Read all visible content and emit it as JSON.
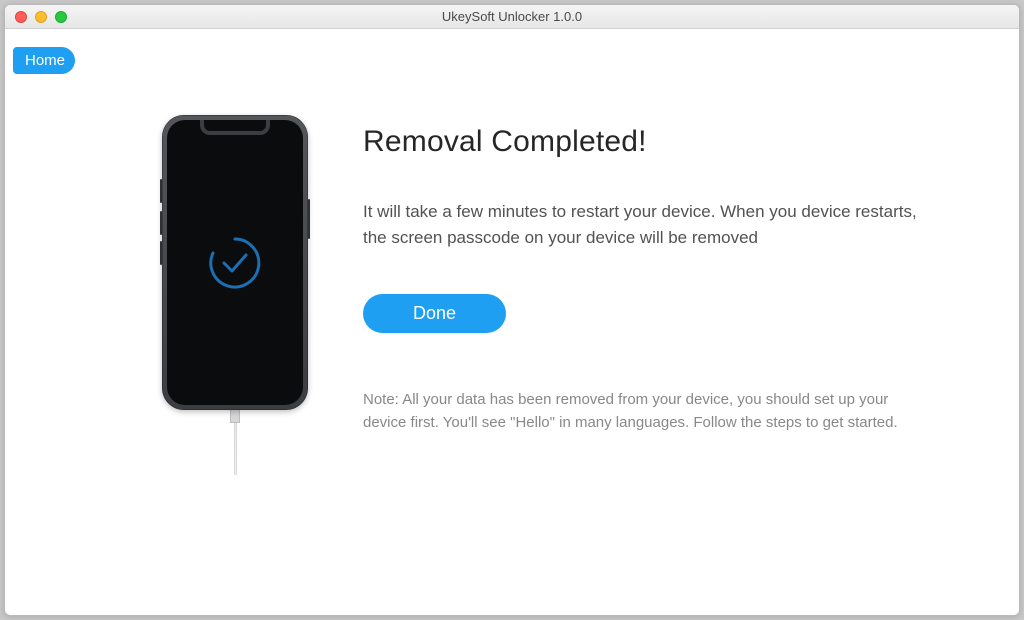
{
  "window": {
    "title": "UkeySoft Unlocker 1.0.0"
  },
  "nav": {
    "home_label": "Home"
  },
  "main": {
    "heading": "Removal Completed!",
    "description": "It will take a few minutes to restart your device. When you device restarts, the screen passcode on your device will be removed",
    "done_label": "Done",
    "note": "Note: All your data has been removed from your device, you should set up your device first. You'll see \"Hello\" in many languages. Follow the steps to get started."
  },
  "colors": {
    "accent": "#1e9ff2"
  }
}
